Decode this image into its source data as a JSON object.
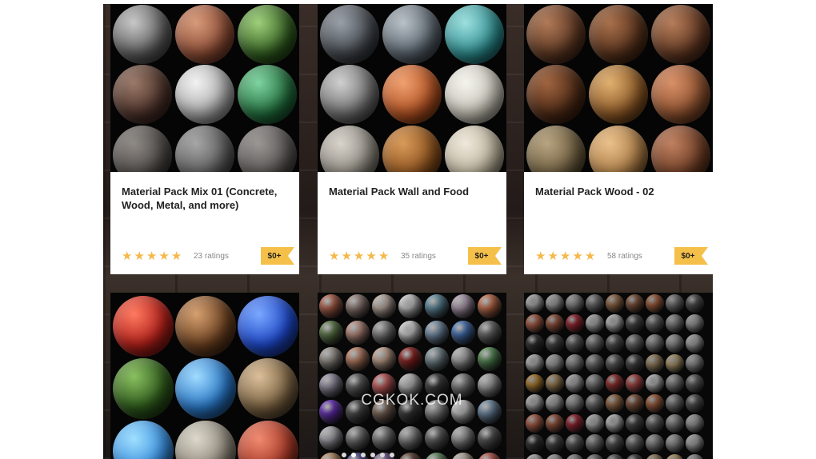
{
  "products": [
    {
      "title": "Material Pack Mix 01 (Concrete, Wood, Metal, and more)",
      "ratings_text": "23 ratings",
      "price": "$0+",
      "stars": 5
    },
    {
      "title": "Material Pack Wall and Food",
      "ratings_text": "35 ratings",
      "price": "$0+",
      "stars": 5
    },
    {
      "title": "Material Pack Wood - 02",
      "ratings_text": "58 ratings",
      "price": "$0+",
      "stars": 5
    }
  ],
  "watermark": "CGKOK.COM",
  "carousel_dots": 6,
  "colors": {
    "star": "#f5b84a",
    "price_tag": "#f5c04a"
  }
}
